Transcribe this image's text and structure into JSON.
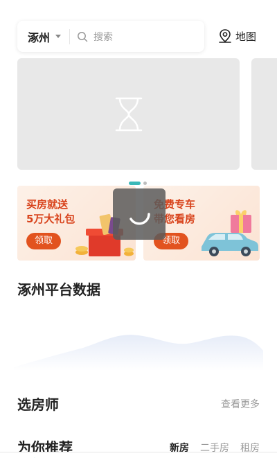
{
  "header": {
    "city": "涿州",
    "search_placeholder": "搜索",
    "map_label": "地图"
  },
  "carousel": {
    "slide_count": 2,
    "active_index": 0
  },
  "promos": [
    {
      "title_line1": "买房就送",
      "title_line2": "5万大礼包",
      "button": "领取"
    },
    {
      "title_line1": "免费专车",
      "title_line2": "带您看房",
      "button": "领取"
    }
  ],
  "sections": {
    "platform_title": "涿州平台数据",
    "agents_title": "选房师",
    "see_more": "查看更多",
    "recommend_title": "为你推荐",
    "recommend_tabs": [
      {
        "label": "新房",
        "active": true
      },
      {
        "label": "二手房",
        "active": false
      },
      {
        "label": "租房",
        "active": false
      }
    ]
  },
  "colors": {
    "accent": "#3bb8b8",
    "promo_orange": "#e2531f",
    "placeholder_gray": "#e8e8e8"
  }
}
